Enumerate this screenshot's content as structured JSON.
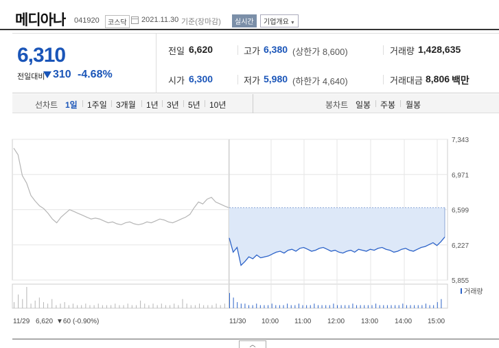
{
  "header": {
    "stock_name": "메디아나",
    "stock_code": "041920",
    "market": "코스닥",
    "date": "2021.11.30",
    "basis": "기준(장마감)",
    "realtime_label": "실시간",
    "company_label": "기업개요",
    "company_arrow": "▼"
  },
  "price": {
    "current": "6,310",
    "diff_label": "전일대비",
    "diff_value": "310",
    "diff_rate": "-4.68%",
    "direction": "down",
    "down_color": "#1a55b8",
    "prev_close_label": "전일",
    "prev_close": "6,620",
    "open_label": "시가",
    "open": "6,300",
    "high_label": "고가",
    "high": "6,380",
    "upper_limit": "(상한가 8,600)",
    "low_label": "저가",
    "low": "5,980",
    "lower_limit": "(하한가 4,640)",
    "volume_label": "거래량",
    "volume": "1,428,635",
    "amount_label": "거래대금",
    "amount": "8,806",
    "amount_unit": "백만"
  },
  "period_bar": {
    "line_chart_label": "선차트",
    "line_periods": [
      "1일",
      "1주일",
      "3개월",
      "1년",
      "3년",
      "5년",
      "10년"
    ],
    "active_period": "1일",
    "candle_chart_label": "봉차트",
    "candle_periods": [
      "일봉",
      "주봉",
      "월봉"
    ]
  },
  "chart_data": {
    "type": "line",
    "title": "",
    "y_ticks": [
      "7,343",
      "6,971",
      "6,599",
      "6,227",
      "5,855"
    ],
    "ylim": [
      5855,
      7343
    ],
    "prev_close_reference": 6620,
    "x_ticks": [
      "11/29",
      "11/30",
      "10:00",
      "11:00",
      "12:00",
      "13:00",
      "14:00",
      "15:00"
    ],
    "prev_day_label": "11/29",
    "prev_day_close": "6,620",
    "prev_day_change": "▼60",
    "prev_day_rate": "(-0.90%)",
    "volume_label": "거래량",
    "series": [
      {
        "name": "11/29",
        "color": "#b5b5b5",
        "values": [
          7250,
          7180,
          6960,
          6880,
          6750,
          6690,
          6640,
          6610,
          6560,
          6500,
          6460,
          6520,
          6560,
          6600,
          6580,
          6560,
          6540,
          6520,
          6500,
          6510,
          6500,
          6480,
          6460,
          6470,
          6450,
          6440,
          6460,
          6470,
          6450,
          6440,
          6450,
          6470,
          6460,
          6480,
          6500,
          6490,
          6470,
          6460,
          6480,
          6500,
          6520,
          6550,
          6620,
          6680,
          6660,
          6710,
          6730,
          6680,
          6660,
          6640,
          6620
        ]
      },
      {
        "name": "11/30",
        "color": "#2b62c8",
        "values": [
          6300,
          6150,
          6200,
          6010,
          6050,
          6100,
          6080,
          6120,
          6090,
          6100,
          6110,
          6130,
          6150,
          6160,
          6140,
          6170,
          6180,
          6160,
          6190,
          6200,
          6180,
          6160,
          6170,
          6190,
          6200,
          6180,
          6160,
          6170,
          6150,
          6140,
          6160,
          6170,
          6150,
          6180,
          6170,
          6160,
          6180,
          6170,
          6190,
          6200,
          6180,
          6170,
          6150,
          6160,
          6180,
          6190,
          6170,
          6160,
          6180,
          6200,
          6210,
          6230,
          6250,
          6220,
          6260,
          6310
        ]
      }
    ],
    "volume_bars": {
      "day1": [
        4,
        9,
        6,
        14,
        3,
        5,
        7,
        4,
        3,
        6,
        2,
        3,
        4,
        2,
        3,
        2,
        2,
        3,
        2,
        2,
        3,
        2,
        2,
        2,
        3,
        2,
        2,
        3,
        2,
        2,
        5,
        3,
        2,
        3,
        2,
        3,
        2,
        2,
        3,
        2,
        6,
        3,
        2,
        2,
        3,
        2,
        2,
        2,
        3,
        2,
        3
      ],
      "day2": [
        10,
        7,
        4,
        3,
        3,
        2,
        2,
        3,
        2,
        2,
        2,
        3,
        2,
        2,
        2,
        3,
        2,
        2,
        3,
        2,
        2,
        2,
        3,
        2,
        2,
        2,
        2,
        3,
        2,
        2,
        2,
        2,
        3,
        2,
        2,
        2,
        2,
        2,
        3,
        2,
        2,
        2,
        2,
        2,
        2,
        3,
        2,
        2,
        2,
        2,
        2,
        3,
        2,
        2,
        4,
        6
      ]
    }
  },
  "ui": {
    "toggle_label": "︿"
  }
}
